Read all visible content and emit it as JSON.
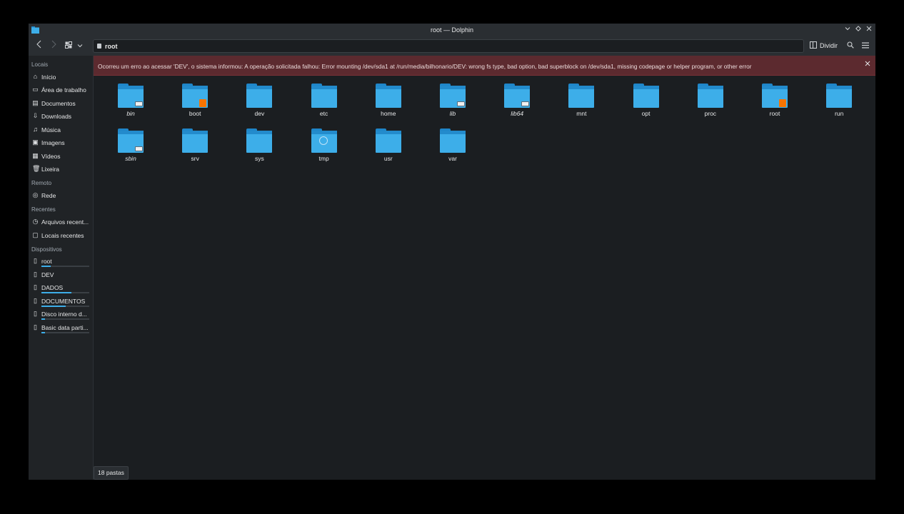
{
  "window": {
    "title": "root — Dolphin",
    "controls": {
      "minimize": "chevron-down-icon",
      "maximize": "diamond-icon",
      "close": "close-icon"
    }
  },
  "toolbar": {
    "back_icon": "chevron-left-icon",
    "forward_icon": "chevron-right-icon",
    "view_icon": "view-mode-icon",
    "view_menu_icon": "chevron-down-icon",
    "location": "root",
    "split_label": "Dividir",
    "search_icon": "search-icon",
    "menu_icon": "hamburger-menu-icon"
  },
  "sidebar": {
    "sections": [
      {
        "title": "Locais"
      },
      {
        "title": "Remoto"
      },
      {
        "title": "Recentes"
      },
      {
        "title": "Dispositivos"
      }
    ],
    "items": [
      {
        "label": "Início",
        "icon": "home-icon"
      },
      {
        "label": "Área de trabalho",
        "icon": "desktop-icon"
      },
      {
        "label": "Documentos",
        "icon": "documents-icon"
      },
      {
        "label": "Downloads",
        "icon": "downloads-icon"
      },
      {
        "label": "Música",
        "icon": "music-icon"
      },
      {
        "label": "Imagens",
        "icon": "images-icon"
      },
      {
        "label": "Vídeos",
        "icon": "videos-icon"
      },
      {
        "label": "Lixeira",
        "icon": "trash-icon"
      },
      {
        "label": "Rede",
        "icon": "network-icon"
      },
      {
        "label": "Arquivos recent...",
        "icon": "recent-files-icon"
      },
      {
        "label": "Locais recentes",
        "icon": "recent-locations-icon"
      },
      {
        "label": "root",
        "icon": "drive-icon",
        "usage": 0.2
      },
      {
        "label": "DEV",
        "icon": "drive-error-icon"
      },
      {
        "label": "DADOS",
        "icon": "drive-icon",
        "usage": 0.62
      },
      {
        "label": "DOCUMENTOS",
        "icon": "drive-icon",
        "usage": 0.5
      },
      {
        "label": "Disco interno d...",
        "icon": "drive-icon",
        "usage": 0.08
      },
      {
        "label": "Basic data parti...",
        "icon": "drive-icon",
        "usage": 0.07
      }
    ]
  },
  "error": {
    "message": "Ocorreu um erro ao acessar 'DEV', o sistema informou: A operação solicitada falhou: Error mounting /dev/sda1 at /run/media/bilhonario/DEV: wrong fs type, bad option, bad superblock on /dev/sda1, missing codepage or helper program, or other error",
    "close_icon": "close-icon"
  },
  "folders": [
    {
      "name": "bin",
      "italic": true,
      "emblem": "link"
    },
    {
      "name": "boot",
      "italic": false,
      "emblem": "lock"
    },
    {
      "name": "dev",
      "italic": false,
      "emblem": ""
    },
    {
      "name": "etc",
      "italic": false,
      "emblem": ""
    },
    {
      "name": "home",
      "italic": false,
      "emblem": ""
    },
    {
      "name": "lib",
      "italic": true,
      "emblem": "link"
    },
    {
      "name": "lib64",
      "italic": true,
      "emblem": "link"
    },
    {
      "name": "mnt",
      "italic": false,
      "emblem": ""
    },
    {
      "name": "opt",
      "italic": false,
      "emblem": ""
    },
    {
      "name": "proc",
      "italic": false,
      "emblem": ""
    },
    {
      "name": "root",
      "italic": false,
      "emblem": "lock"
    },
    {
      "name": "run",
      "italic": false,
      "emblem": ""
    },
    {
      "name": "sbin",
      "italic": true,
      "emblem": "link"
    },
    {
      "name": "srv",
      "italic": false,
      "emblem": ""
    },
    {
      "name": "sys",
      "italic": false,
      "emblem": ""
    },
    {
      "name": "tmp",
      "italic": false,
      "emblem": "clock"
    },
    {
      "name": "usr",
      "italic": false,
      "emblem": ""
    },
    {
      "name": "var",
      "italic": false,
      "emblem": ""
    }
  ],
  "status": {
    "text": "18 pastas"
  },
  "colors": {
    "accent": "#3daee9",
    "error_bg": "#5c2a2f",
    "lock": "#f67400"
  }
}
